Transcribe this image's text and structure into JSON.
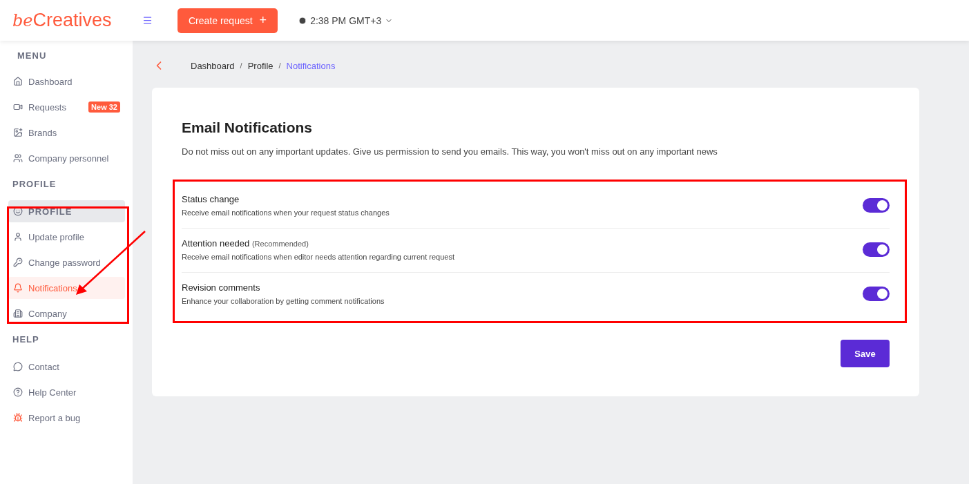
{
  "logo": {
    "script": "be",
    "word": "Creatives"
  },
  "header": {
    "create_button": "Create request",
    "create_icon": "+",
    "time": "2:38 PM GMT+3"
  },
  "sidebar": {
    "sections": [
      {
        "title": "MENU",
        "items": [
          {
            "label": "Dashboard",
            "kind": "link",
            "selected": false
          },
          {
            "label": "Requests",
            "kind": "link",
            "selected": false,
            "badge": "New 32"
          },
          {
            "label": "Brands",
            "kind": "link",
            "selected": false
          },
          {
            "label": "Company personnel",
            "kind": "link",
            "selected": false
          }
        ]
      },
      {
        "title": "PROFILE",
        "items": [
          {
            "label": "PROFILE",
            "kind": "heading",
            "selected": false
          },
          {
            "label": "Update profile",
            "kind": "link",
            "selected": false
          },
          {
            "label": "Change password",
            "kind": "link",
            "selected": false
          },
          {
            "label": "Notifications",
            "kind": "link",
            "selected": true
          },
          {
            "label": "Company",
            "kind": "link",
            "selected": false
          }
        ]
      },
      {
        "title": "HELP",
        "items": [
          {
            "label": "Contact",
            "kind": "link",
            "selected": false
          },
          {
            "label": "Help Center",
            "kind": "link",
            "selected": false
          },
          {
            "label": "Report a bug",
            "kind": "link",
            "selected": false
          }
        ]
      }
    ]
  },
  "breadcrumb": [
    {
      "label": "Dashboard",
      "selected": false
    },
    {
      "separator": "/",
      "label": "Profile",
      "selected": false
    },
    {
      "separator": "/",
      "label": "Notifications",
      "selected": true
    }
  ],
  "card": {
    "title": "Email Notifications",
    "description": "Do not miss out on any important updates. Give us permission to send you emails. This way, you won't miss out on any important news",
    "settings": [
      {
        "title": "Status change",
        "description": "Receive email notifications when your request status changes",
        "on": true
      },
      {
        "title": "Attention needed",
        "note": "(Recommended)",
        "description": "Receive email notifications when editor needs attention regarding current request",
        "on": true
      },
      {
        "title": "Revision comments",
        "description": "Enhance your collaboration by getting comment notifications",
        "on": true
      }
    ],
    "save_button": "Save"
  }
}
